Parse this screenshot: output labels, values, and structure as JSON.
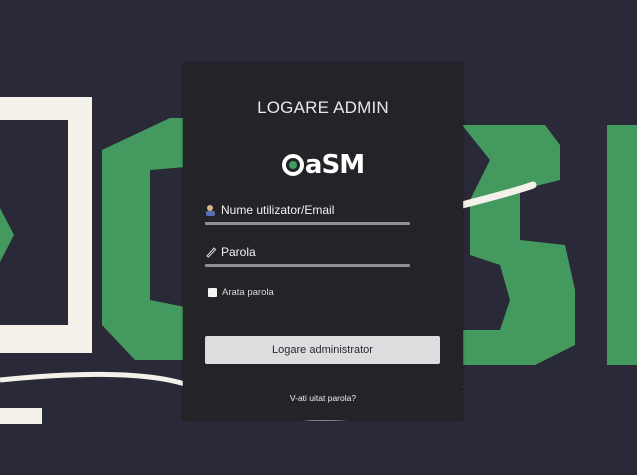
{
  "background": {
    "brand_green": "#44995f",
    "ring_white": "#f3f1ea",
    "bg_color": "#2a2937"
  },
  "panel": {
    "title": "LOGARE ADMIN",
    "logo": {
      "text": "aSM",
      "icon": "recycle-icon"
    },
    "username": {
      "label": "Nume utilizator/Email",
      "icon": "user-icon"
    },
    "password": {
      "label": "Parola",
      "icon": "pencil-icon"
    },
    "show_password": {
      "label": "Arata parola",
      "checked": false
    },
    "submit_label": "Logare administrator",
    "forgot_label": "V-ati uitat parola?"
  }
}
